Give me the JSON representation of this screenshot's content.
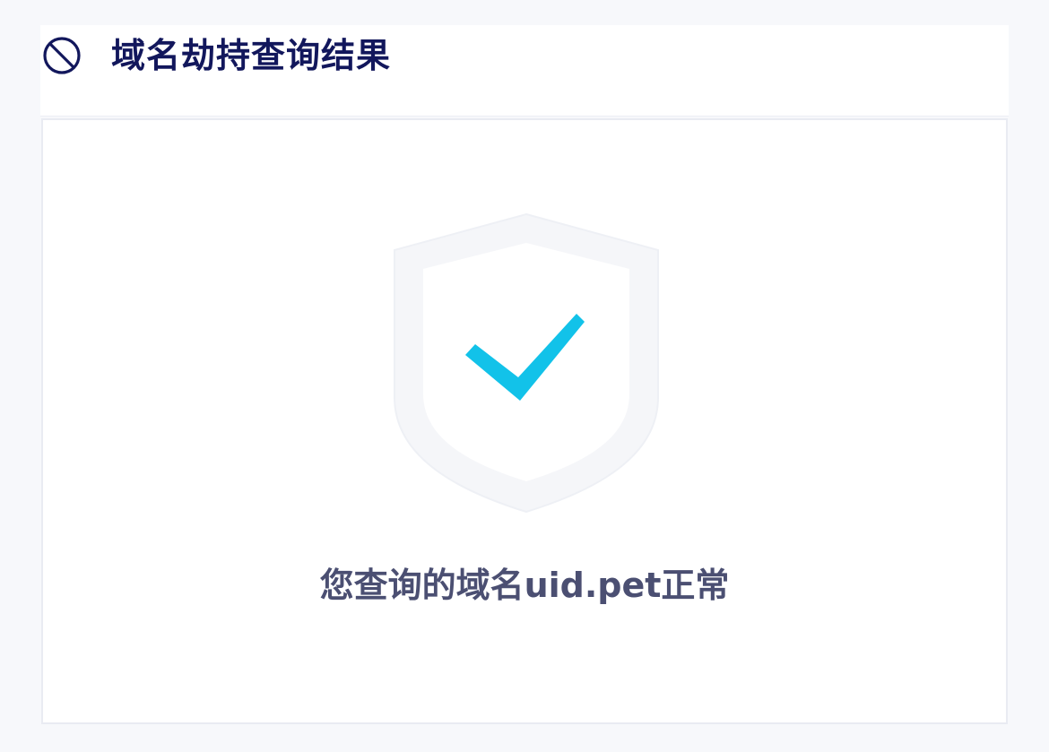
{
  "header": {
    "title": "域名劫持查询结果",
    "icon": "prohibited-icon",
    "title_color": "#12175c"
  },
  "result": {
    "icon": "shield-check-icon",
    "message": "您查询的域名uid.pet正常",
    "check_color": "#12c2e9",
    "text_color": "#4b4f72"
  }
}
